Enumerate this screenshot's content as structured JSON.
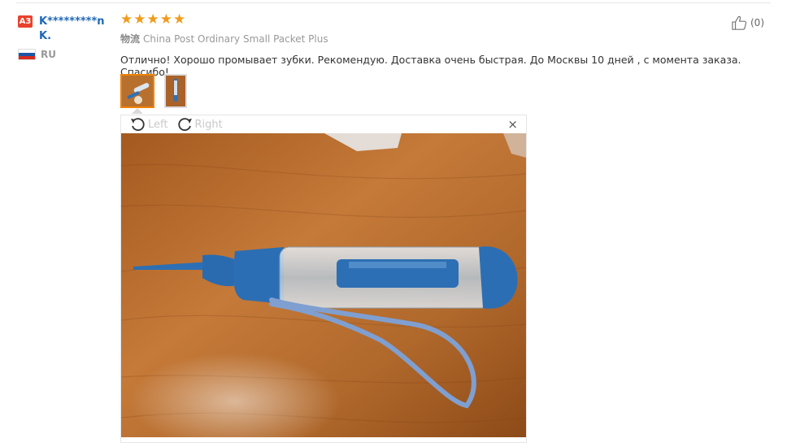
{
  "reviewer": {
    "badge": "A3",
    "name": "K*********n K.",
    "country_code": "RU",
    "flag_colors": [
      "#ffffff",
      "#1c57a7",
      "#d52b1e"
    ]
  },
  "review": {
    "rating": 5,
    "star_color": "#f09b1b",
    "shipping_prefix": "物流",
    "shipping_method": "China Post Ordinary Small Packet Plus",
    "text": "Отлично! Хорошо промывает зубки. Рекомендую. Доставка очень быстрая. До Москвы 10 дней , с момента заказа. Спасибо!"
  },
  "helpful": {
    "icon": "thumbs-up-icon",
    "count": "(0)"
  },
  "images": {
    "thumbnails": [
      "photo-1",
      "photo-2"
    ],
    "active_index": 0
  },
  "viewer": {
    "rotate_left_label": "Left",
    "rotate_right_label": "Right",
    "close_glyph": "×"
  }
}
